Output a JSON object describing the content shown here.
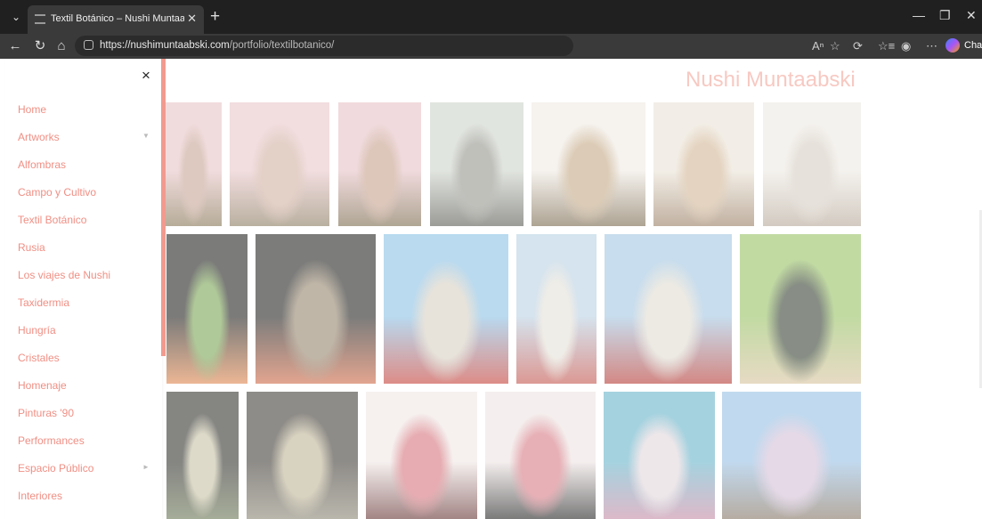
{
  "browser": {
    "tab_title": "Textil Botánico – Nushi Muntaabski",
    "new_tab_symbol": "+",
    "url_domain": "https://nushimuntaabski.com",
    "url_path": "/portfolio/textilbotanico/",
    "chat_label": "Chat"
  },
  "site": {
    "title": "Nushi Muntaabski",
    "accent_color": "#f29a8f"
  },
  "sidebar": {
    "close_symbol": "×",
    "items": [
      {
        "label": "Home"
      },
      {
        "label": "Artworks",
        "submenu": "▼"
      },
      {
        "label": "Alfombras"
      },
      {
        "label": "Campo y Cultivo"
      },
      {
        "label": "Textil Botánico"
      },
      {
        "label": "Rusia"
      },
      {
        "label": "Los viajes de Nushi"
      },
      {
        "label": "Taxidermia"
      },
      {
        "label": "Hungría"
      },
      {
        "label": "Cristales"
      },
      {
        "label": "Homenaje"
      },
      {
        "label": "Pinturas '90"
      },
      {
        "label": "Performances"
      },
      {
        "label": "Espacio Público",
        "submenu": "►"
      },
      {
        "label": "Interiores"
      }
    ]
  },
  "gallery": {
    "photos": [
      {
        "name": "photo-pink-cape-desert-front",
        "colors": [
          "#e9c7c9",
          "#c9a89a",
          "#8a7a5a"
        ]
      },
      {
        "name": "photo-pink-cape-desert-arms",
        "colors": [
          "#eac9cb",
          "#d2b3a4",
          "#8f8066"
        ]
      },
      {
        "name": "photo-pink-cape-desert-back",
        "colors": [
          "#e8c4c8",
          "#c9a592",
          "#7f6f52"
        ]
      },
      {
        "name": "photo-dark-dress-window",
        "colors": [
          "#cfd5cc",
          "#9a9a92",
          "#5f5f58"
        ]
      },
      {
        "name": "photo-white-cape-garden",
        "colors": [
          "#f0ebe4",
          "#c7ad8b",
          "#7d6c52"
        ]
      },
      {
        "name": "photo-print-closeup",
        "colors": [
          "#ebe4d8",
          "#d4b99a",
          "#9c8268"
        ]
      },
      {
        "name": "photo-fabric-drape",
        "colors": [
          "#eeeae4",
          "#d7cfc4",
          "#b8ab9c"
        ]
      },
      {
        "name": "photo-black-cape-artichoke-front",
        "colors": [
          "#2a2a28",
          "#7fa85a",
          "#e08a54"
        ]
      },
      {
        "name": "photo-black-cape-artichoke-back",
        "colors": [
          "#2c2c2a",
          "#9a8a72",
          "#d06e4c"
        ]
      },
      {
        "name": "photo-white-cape-pool",
        "colors": [
          "#8ec3e6",
          "#d9d2c4",
          "#c8473f"
        ]
      },
      {
        "name": "photo-white-cape-standing",
        "colors": [
          "#bcd3e4",
          "#e6e2d8",
          "#c65a52"
        ]
      },
      {
        "name": "photo-white-cape-red-print",
        "colors": [
          "#a6c8e2",
          "#e1ddd2",
          "#b8403a"
        ]
      },
      {
        "name": "photo-dark-cape-vineyard",
        "colors": [
          "#9cc46a",
          "#3f4a3a",
          "#d8c4a0"
        ]
      },
      {
        "name": "photo-dark-print-detail",
        "colors": [
          "#3a3a36",
          "#c9c4a8",
          "#6f7a5a"
        ]
      },
      {
        "name": "photo-dark-cape-hall",
        "colors": [
          "#4a4640",
          "#c0b79a",
          "#8f8a7a"
        ]
      },
      {
        "name": "photo-pink-leaf-dress",
        "colors": [
          "#f0e8e6",
          "#d77a82",
          "#6a3a3a"
        ]
      },
      {
        "name": "photo-pink-leaf-detail",
        "colors": [
          "#eee6e4",
          "#d8808a",
          "#2a2a2a"
        ]
      },
      {
        "name": "photo-pink-cape-window",
        "colors": [
          "#6fb7cc",
          "#e3d8dc",
          "#c78fa8"
        ]
      },
      {
        "name": "photo-lavender-cape-terrace",
        "colors": [
          "#9cc2e4",
          "#d6c2d8",
          "#8a7a6a"
        ]
      }
    ]
  }
}
